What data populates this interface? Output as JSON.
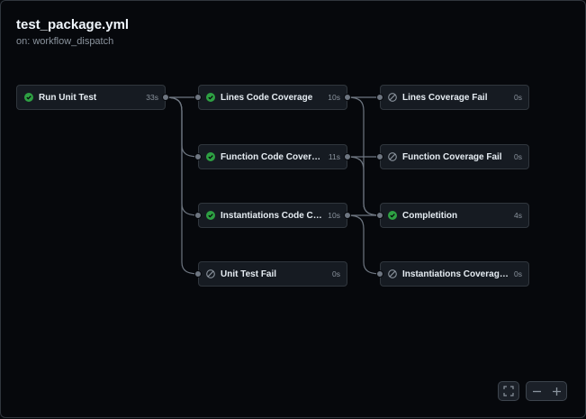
{
  "workflow": {
    "title": "test_package.yml",
    "trigger": "on: workflow_dispatch"
  },
  "jobs": [
    {
      "name": "Run Unit Test",
      "duration": "33s",
      "status": "success"
    },
    {
      "name": "Lines Code Coverage",
      "duration": "10s",
      "status": "success"
    },
    {
      "name": "Function Code Coverage",
      "duration": "11s",
      "status": "success"
    },
    {
      "name": "Instantiations Code Cove...",
      "duration": "10s",
      "status": "success"
    },
    {
      "name": "Unit Test Fail",
      "duration": "0s",
      "status": "skipped"
    },
    {
      "name": "Lines Coverage Fail",
      "duration": "0s",
      "status": "skipped"
    },
    {
      "name": "Function Coverage Fail",
      "duration": "0s",
      "status": "skipped"
    },
    {
      "name": "Completition",
      "duration": "4s",
      "status": "success"
    },
    {
      "name": "Instantiations Coverage Fail",
      "duration": "0s",
      "status": "skipped"
    }
  ],
  "controls": {
    "fullscreen_icon": "fullscreen-icon",
    "zoom_out_icon": "minus-icon",
    "zoom_in_icon": "plus-icon"
  },
  "colors": {
    "success": "#2ea043",
    "skipped": "#8b949e",
    "edge": "#6e7681"
  }
}
